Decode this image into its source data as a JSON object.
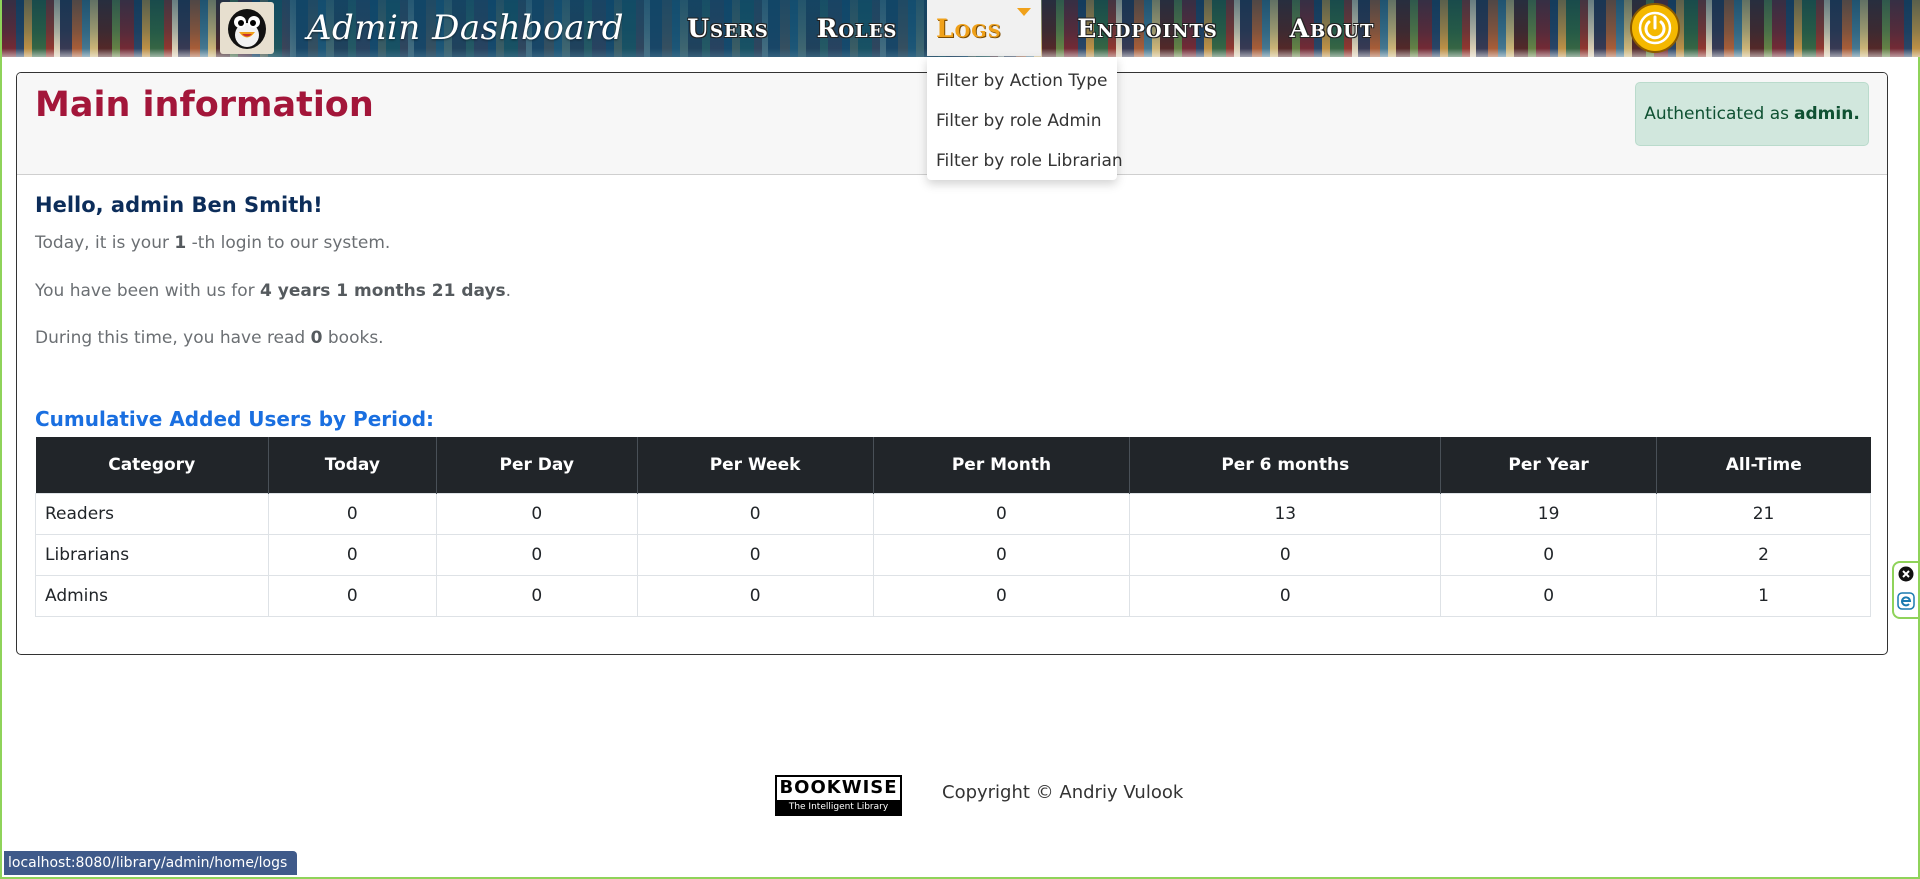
{
  "header": {
    "brand": "Admin Dashboard",
    "nav": [
      {
        "label": "Users"
      },
      {
        "label": "Roles"
      },
      {
        "label": "Logs"
      },
      {
        "label": "Endpoints"
      },
      {
        "label": "About"
      }
    ],
    "active_nav": "Logs"
  },
  "logs_dropdown": {
    "items": [
      "Filter by Action Type",
      "Filter by role Admin",
      "Filter by role Librarian"
    ]
  },
  "main": {
    "title": "Main information",
    "auth_prefix": "Authenticated as",
    "auth_user": "admin.",
    "greeting": "Hello, admin Ben Smith!",
    "login_pre": "Today, it is your",
    "login_count": "1",
    "login_post": "-th login to our system.",
    "tenure_pre": "You have been with us for",
    "tenure_value": "4 years 1 months 21 days",
    "tenure_post": ".",
    "read_pre": "During this time, you have read",
    "read_count": "0",
    "read_post": "books.",
    "section_title": "Cumulative Added Users by Period:"
  },
  "table": {
    "headers": [
      "Category",
      "Today",
      "Per Day",
      "Per Week",
      "Per Month",
      "Per 6 months",
      "Per Year",
      "All-Time"
    ],
    "rows": [
      [
        "Readers",
        "0",
        "0",
        "0",
        "0",
        "13",
        "19",
        "21"
      ],
      [
        "Librarians",
        "0",
        "0",
        "0",
        "0",
        "0",
        "0",
        "2"
      ],
      [
        "Admins",
        "0",
        "0",
        "0",
        "0",
        "0",
        "0",
        "1"
      ]
    ]
  },
  "footer": {
    "logo_text": "BOOKWISE",
    "logo_tagline": "The Intelligent Library",
    "copyright": "Copyright © Andriy Vulook"
  },
  "statusbar": {
    "url": "localhost:8080/library/admin/home/logs"
  },
  "colors": {
    "title": "#a3163a",
    "section_title": "#1a6fe0",
    "nav_active": "#f0a11a",
    "table_header_bg": "#212529",
    "auth_box_bg": "#d1e7dd"
  },
  "icons": [
    "penguin-logo-icon",
    "power-icon",
    "caret-down-icon",
    "close-icon",
    "extension-e-icon"
  ]
}
